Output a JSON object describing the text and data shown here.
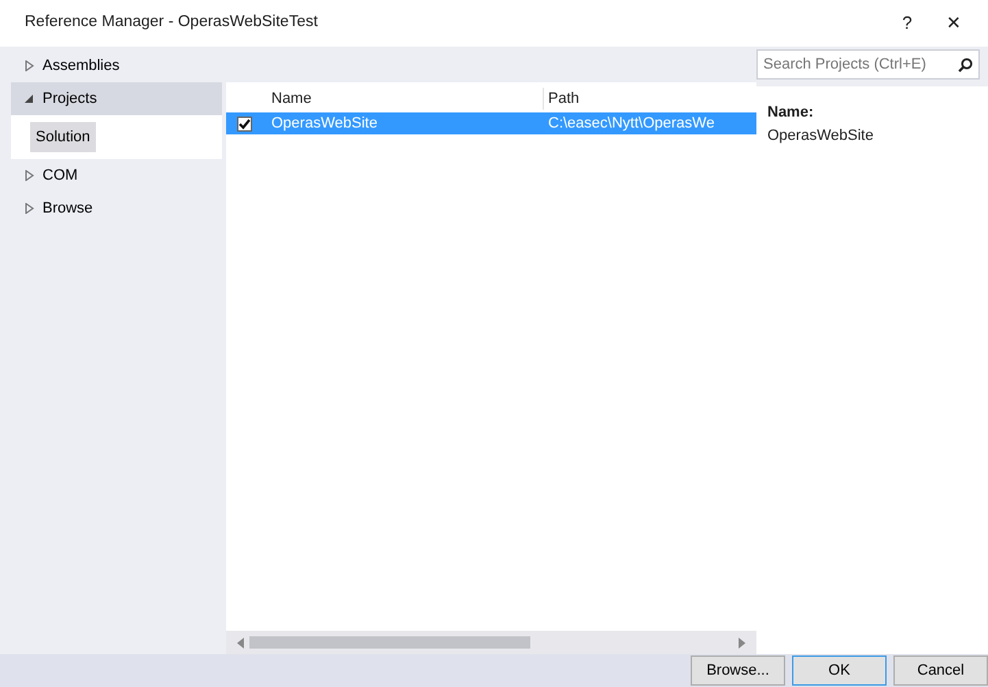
{
  "window": {
    "title": "Reference Manager - OperasWebSiteTest",
    "help": "?",
    "close": "✕"
  },
  "sidebar": {
    "items": [
      {
        "label": "Assemblies",
        "expanded": false,
        "selected": false
      },
      {
        "label": "Projects",
        "expanded": true,
        "selected": true,
        "children": [
          {
            "label": "Solution",
            "selected": true
          }
        ]
      },
      {
        "label": "COM",
        "expanded": false,
        "selected": false
      },
      {
        "label": "Browse",
        "expanded": false,
        "selected": false
      }
    ]
  },
  "search": {
    "placeholder": "Search Projects (Ctrl+E)"
  },
  "table": {
    "columns": [
      "Name",
      "Path"
    ],
    "rows": [
      {
        "checked": true,
        "selected": true,
        "cells": [
          "OperasWebSite",
          "C:\\easec\\Nytt\\OperasWe"
        ]
      }
    ]
  },
  "details": {
    "label": "Name:",
    "value": "OperasWebSite"
  },
  "buttons": [
    "Browse...",
    "OK",
    "Cancel"
  ]
}
